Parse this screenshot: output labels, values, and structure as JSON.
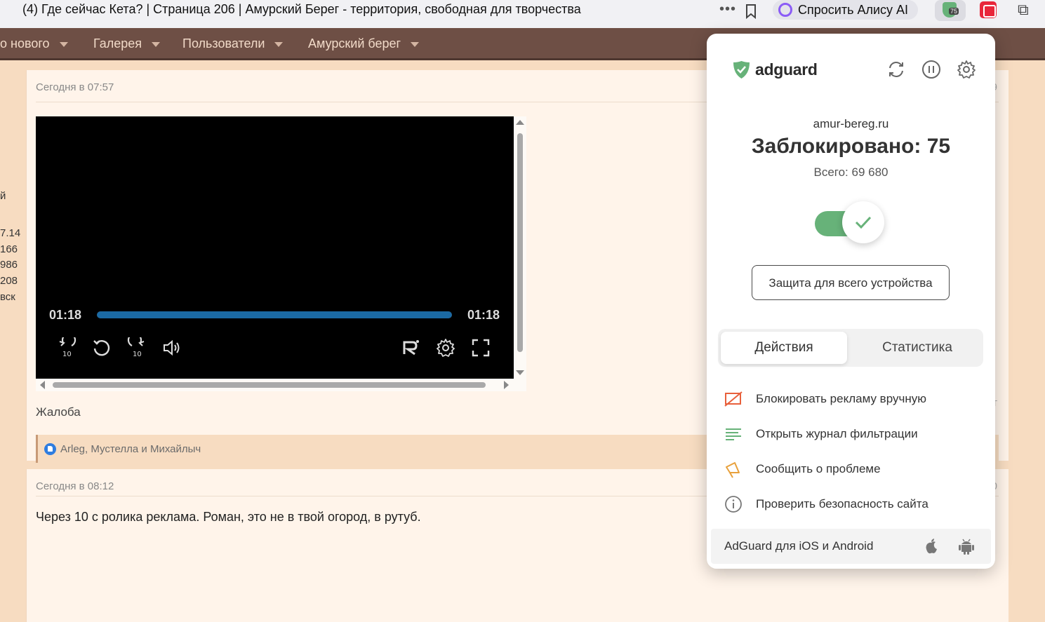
{
  "browser": {
    "tab_title": "(4) Где сейчас Кета? | Страница 206 | Амурский Берег - территория, свободная для творчества",
    "more_icon": "more-dots-icon",
    "alice_label": "Спросить Алису AI",
    "adguard_badge": "75"
  },
  "nav": {
    "items": [
      {
        "label": "о нового"
      },
      {
        "label": "Галерея"
      },
      {
        "label": "Пользователи"
      },
      {
        "label": "Амурский берег"
      }
    ]
  },
  "sidebar": {
    "lines": [
      "й",
      "7.14",
      "166",
      "986",
      "208",
      "вск"
    ]
  },
  "posts": [
    {
      "time": "Сегодня в 07:57",
      "right_num": "9",
      "video": {
        "time_current": "01:18",
        "time_total": "01:18",
        "progress_fraction": 1.0,
        "accent_color": "#1b6aa4"
      },
      "complaint": "Жалоба",
      "right_side": "т",
      "likes": "Arleg, Мустелла и Михайлыч"
    },
    {
      "time": "Сегодня в 08:12",
      "right_num": "0",
      "message": "Через 10 с ролика реклама. Роман, это не в твой огород, в рутуб."
    }
  ],
  "adguard": {
    "logo": "adguard",
    "domain": "amur-bereg.ru",
    "blocked": "Заблокировано: 75",
    "total": "Всего: 69 680",
    "protection_enabled": true,
    "accent_color": "#67b279",
    "device_button": "Защита для всего устройства",
    "tabs": {
      "actions": "Действия",
      "stats": "Статистика"
    },
    "actions": [
      {
        "icon": "block-ad-icon",
        "label": "Блокировать рекламу вручную"
      },
      {
        "icon": "filter-log-icon",
        "label": "Открыть журнал фильтрации"
      },
      {
        "icon": "report-problem-icon",
        "label": "Сообщить о проблеме"
      },
      {
        "icon": "info-icon",
        "label": "Проверить безопасность сайта"
      }
    ],
    "footer": "AdGuard для iOS и Android"
  }
}
